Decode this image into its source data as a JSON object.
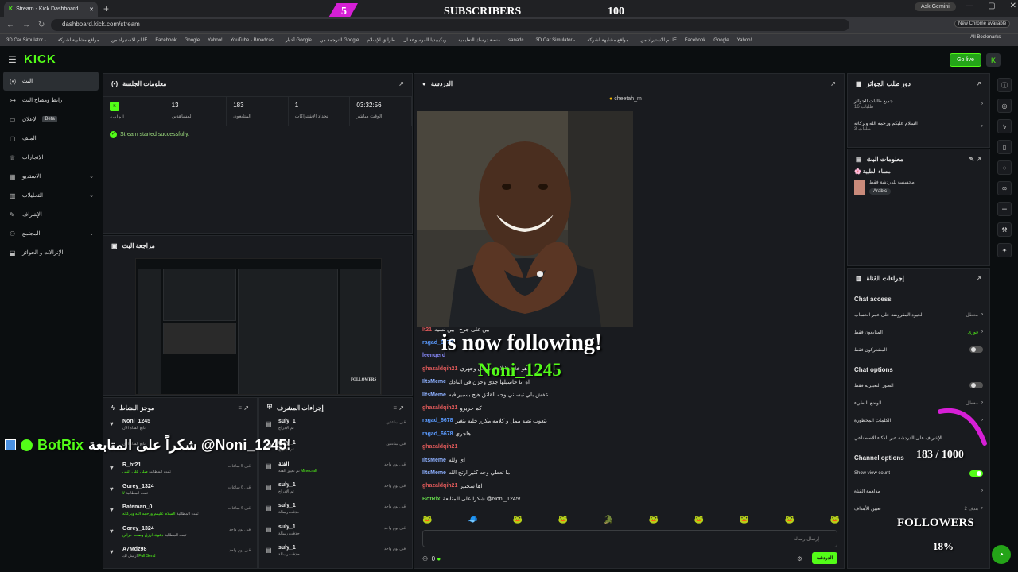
{
  "browser": {
    "tab_title": "Stream - Kick Dashboard",
    "url": "dashboard.kick.com/stream",
    "gemini": "Ask Gemini",
    "chrome_available": "New Chrome available",
    "all_bookmarks": "All Bookmarks",
    "bookmarks": [
      "3D Car Simulator -...",
      "مواقع مشابهة لشركة...",
      "لم الاستيراد من IE",
      "Facebook",
      "Google",
      "Yahoo!",
      "YouTube - Broadcas...",
      "أخبار Google",
      "الترجمة من Google",
      "طرائق الإسلام",
      "ويكيبيديا الموسوعة ال...",
      "منصة درسك التعليمية",
      "sanadc...",
      "3D Car Simulator -...",
      "مواقع مشابهة لشركة...",
      "لم الاستيراد من IE",
      "Facebook",
      "Google",
      "Yahoo!"
    ]
  },
  "sub_overlay": {
    "count": "5",
    "label": "SUBSCRIBERS",
    "goal": "100"
  },
  "topnav": {
    "logo": "KICK",
    "go_live": "Go live"
  },
  "sidebar": {
    "items": [
      {
        "label": "البث",
        "icon": "broadcast-icon"
      },
      {
        "label": "رابط ومفتاح البث",
        "icon": "key-icon"
      },
      {
        "label": "الإعلان",
        "beta": "Beta",
        "icon": "ad-icon"
      },
      {
        "label": "الملف",
        "icon": "profile-icon"
      },
      {
        "label": "الإنجازات",
        "icon": "trophy-icon"
      },
      {
        "label": "الاستديو",
        "icon": "studio-icon"
      },
      {
        "label": "التحليلات",
        "icon": "analytics-icon"
      },
      {
        "label": "الإشراف",
        "icon": "moderation-icon"
      },
      {
        "label": "المجتمع",
        "icon": "community-icon"
      },
      {
        "label": "الإنزالات و الجوائز",
        "icon": "drops-icon"
      }
    ]
  },
  "session": {
    "title": "معلومات الجلسة",
    "stats": [
      {
        "label": "الجلسة",
        "value": ""
      },
      {
        "label": "المشاهدين",
        "value": "13"
      },
      {
        "label": "المتابعون",
        "value": "183"
      },
      {
        "label": "تحداد الاشتراكات",
        "value": "1"
      },
      {
        "label": "الوقت مباشر",
        "value": "03:32:56"
      }
    ],
    "success": "Stream started successfully."
  },
  "review": {
    "title": "مراجعة البث",
    "mini_followers": "FOLLOWERS"
  },
  "activity": {
    "title": "موجز النشاط",
    "rows": [
      {
        "name": "Noni_1245",
        "desc": "تابع القناة الآن",
        "time": ""
      },
      {
        "name": "",
        "desc": "تابع القناة الآن",
        "time": ""
      },
      {
        "name": "R_hf21",
        "desc": "تمت المطالبة",
        "extra": "صلي على النبي",
        "time": "قبل 5 ساعات"
      },
      {
        "name": "Gorey_1324",
        "desc": "تمت المطالبة",
        "extra": "لا",
        "time": "قبل 6 ساعات"
      },
      {
        "name": "Bateman_0",
        "desc": "تمت المطالبة",
        "extra": "السلام عليكم ورحمه الله وبركاته",
        "time": "قبل 6 ساعات"
      },
      {
        "name": "Gorey_1324",
        "desc": "تمت المطالبة",
        "extra": "دعوة، ارزق وصحه حراين",
        "time": "قبل يوم واحد"
      },
      {
        "name": "A7Mdz98",
        "desc": "أرسل لك",
        "extra": "Full Send",
        "time": "قبل يوم واحد"
      }
    ]
  },
  "mod": {
    "title": "إجراءات المشرف",
    "rows": [
      {
        "name": "suly_1",
        "desc": "تم الإدراج",
        "time": "قبل ساعتين"
      },
      {
        "name": "suly_1",
        "desc": "تم الإدراج",
        "time": "قبل ساعتين"
      },
      {
        "name": "الفئة",
        "desc": "تم تغيير الفئة",
        "extra": "Minecraft",
        "time": "قبل يوم واحد"
      },
      {
        "name": "suly_1",
        "desc": "تم الإدراج",
        "time": "قبل يوم واحد"
      },
      {
        "name": "suly_1",
        "desc": "حذفت رسالة",
        "time": "قبل يوم واحد"
      },
      {
        "name": "suly_1",
        "desc": "حذفت رسالة",
        "time": "قبل يوم واحد"
      },
      {
        "name": "suly_1",
        "desc": "حذفت رسالة",
        "time": "قبل يوم واحد"
      }
    ]
  },
  "chat": {
    "title": "الدردشة",
    "pinned_user": "cheetah_m",
    "follow_text": "is now following!",
    "follow_name": "Noni_1245",
    "messages": [
      {
        "user": "lt21",
        "text": "بين على جرح ! بين نسيه",
        "cls": "u1"
      },
      {
        "user": "ragad_6678",
        "text": "",
        "cls": "u4"
      },
      {
        "user": "leenqerd",
        "text": "",
        "cls": "u2"
      },
      {
        "user": "ghazaldqih21",
        "text": "هو خل ولا لازم اشتغل وجهري",
        "cls": "u1"
      },
      {
        "user": "IltsMeme",
        "text": "اه انا حاسبلها جدي وحزن في النادك",
        "cls": "u3"
      },
      {
        "user": "IltsMeme",
        "text": "عفش بلي تبسلني وجه القاتق هيج بسبير فيه",
        "cls": "u3"
      },
      {
        "user": "ghazaldqih21",
        "text": "كم حريرو",
        "cls": "u1"
      },
      {
        "user": "ragad_6678",
        "text": "يتعوب نصه ممل و كلامه مكرر خليه يتغير",
        "cls": "u4"
      },
      {
        "user": "ragad_6678",
        "text": "هاجري",
        "cls": "u4"
      },
      {
        "user": "ghazaldqih21",
        "text": "",
        "cls": "u1"
      },
      {
        "user": "IltsMeme",
        "text": "اي ولله",
        "cls": "u3"
      },
      {
        "user": "IltsMeme",
        "text": "ما تعطي وجه كثير ارتح الله",
        "cls": "u3"
      },
      {
        "user": "ghazaldqih21",
        "text": "اها سجنير",
        "cls": "u1"
      },
      {
        "user": "BotRix",
        "text": "شكرا على المتابعة @Noni_1245!",
        "cls": "u5"
      }
    ],
    "input_placeholder": "إرسال رسالة",
    "send": "الدردشة",
    "viewers_icon": "0"
  },
  "rewards": {
    "title": "دور طلب الجوائز",
    "rows": [
      {
        "title": "جميع طلبات الجوائز",
        "sub": "طلبات 16"
      },
      {
        "title": "السلام عليكم ورحمه الله وبركاته",
        "sub": "طلبات 3"
      }
    ]
  },
  "info": {
    "title": "معلومات البث",
    "stream_title": "🌸 مساء الطيبة",
    "category": "محسسة للدردشة فقط",
    "lang": "Arabic"
  },
  "channel": {
    "title": "إجراءات القناة",
    "chat_access": "Chat access",
    "rows1": [
      {
        "label": "الجيود المفروضة على عمر الحساب",
        "value": "معطل"
      },
      {
        "label": "المتابعون فقط",
        "value": "فوري"
      },
      {
        "label": "المشتركون فقط",
        "value": ""
      }
    ],
    "chat_options": "Chat options",
    "rows2": [
      {
        "label": "الصور التعبيرية فقط",
        "value": ""
      },
      {
        "label": "الوضع البطيء",
        "value": "معطل"
      },
      {
        "label": "الكلمات المحظورة",
        "value": ""
      },
      {
        "label": "الإشراف على الدردشة عبر الذكاء الاصطناعي",
        "value": ""
      }
    ],
    "channel_options": "Channel options",
    "rows3": [
      {
        "label": "Show view count",
        "value": ""
      },
      {
        "label": "مداهمة القناة",
        "value": ""
      },
      {
        "label": "تعيين الأهداف",
        "value": "هدف 2"
      }
    ]
  },
  "overlays": {
    "botrix_name": "BotRix",
    "botrix_msg": "شكراً على المتابعة @Noni_1245!",
    "followers_count": "183 / 1000",
    "followers_label": "FOLLOWERS",
    "followers_pct": "18%"
  },
  "colors": {
    "accent": "#53fc18",
    "bg": "#0b0e10",
    "panel": "#191b1f"
  }
}
